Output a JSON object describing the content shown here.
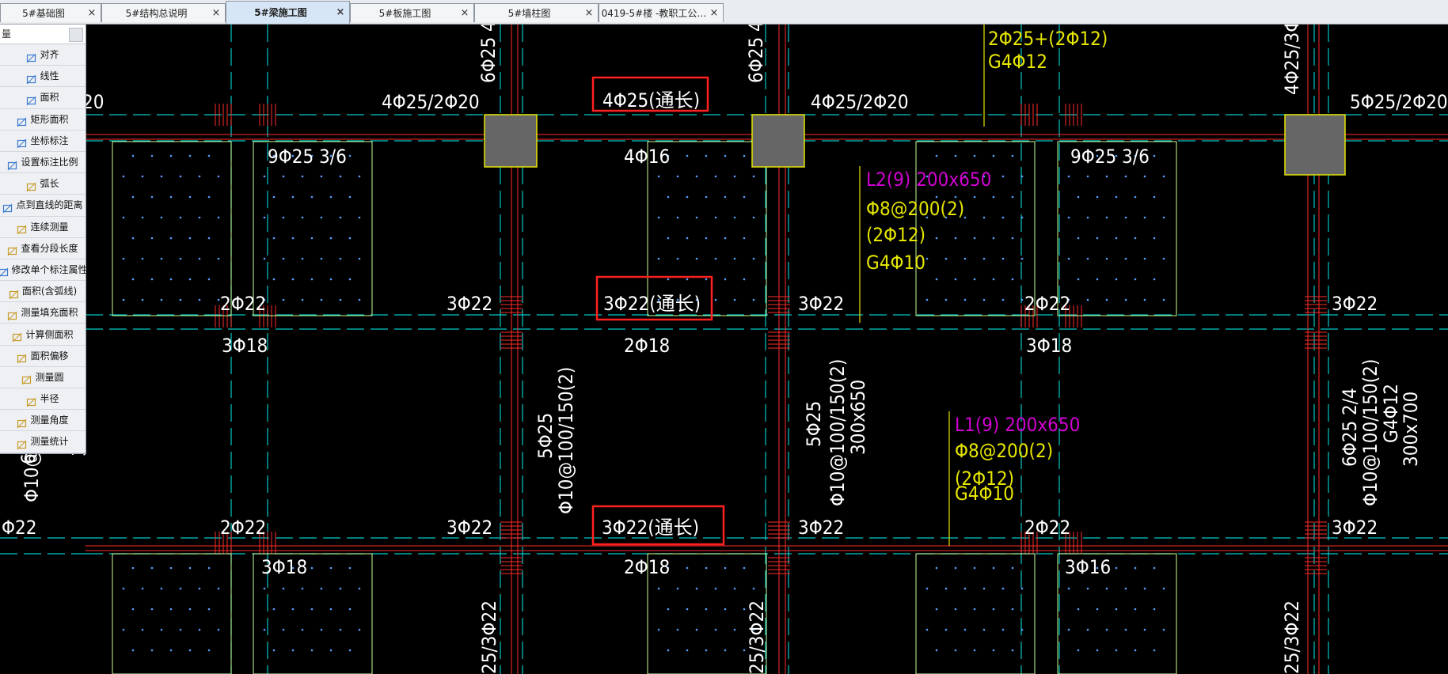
{
  "tabs": [
    {
      "label": "5#基础图",
      "active": false
    },
    {
      "label": "5#结构总说明",
      "active": false
    },
    {
      "label": "5#梁施工图",
      "active": true
    },
    {
      "label": "5#板施工图",
      "active": false
    },
    {
      "label": "5#墙柱图",
      "active": false
    },
    {
      "label": "0419-5#楼 -教职工公…",
      "active": false
    }
  ],
  "close_glyph": "×",
  "tool_panel": {
    "head": "量",
    "tools": [
      {
        "label": "对齐",
        "icon": "align-icon"
      },
      {
        "label": "线性",
        "icon": "linear-icon"
      },
      {
        "label": "面积",
        "icon": "area-icon"
      },
      {
        "label": "矩形面积",
        "icon": "rect-area-icon"
      },
      {
        "label": "坐标标注",
        "icon": "coordinate-icon"
      },
      {
        "label": "设置标注比例",
        "icon": "scale-icon"
      },
      {
        "label": "弧长",
        "icon": "arc-icon"
      },
      {
        "label": "点到直线的距离",
        "icon": "point-line-icon"
      },
      {
        "label": "连续测量",
        "icon": "continuous-icon"
      },
      {
        "label": "查看分段长度",
        "icon": "segment-icon"
      },
      {
        "label": "修改单个标注属性",
        "icon": "edit-dim-icon"
      },
      {
        "label": "面积(含弧线)",
        "icon": "arc-area-icon"
      },
      {
        "label": "测量填充面积",
        "icon": "fill-area-icon"
      },
      {
        "label": "计算侧面积",
        "icon": "side-area-icon"
      },
      {
        "label": "面积偏移",
        "icon": "offset-icon"
      },
      {
        "label": "测量圆",
        "icon": "circle-icon"
      },
      {
        "label": "半径",
        "icon": "radius-icon"
      },
      {
        "label": "测量角度",
        "icon": "angle-icon"
      },
      {
        "label": "测量统计",
        "icon": "stats-icon"
      }
    ]
  },
  "colors": {
    "axis": "#00c8c8",
    "beam": "#ff2a2a",
    "slab": "#c8ff96",
    "text_white": "#ffffff",
    "text_yellow": "#e6e600",
    "text_magenta": "#e000e0",
    "column": "#666666",
    "highlight": "#ff2020"
  },
  "drawing": {
    "labels_white": [
      "4Φ25/2Φ20",
      "4Φ25/2Φ20",
      "5Φ25/2Φ20",
      "20",
      "9Φ25 3/6",
      "9Φ25 3/6",
      "4Φ16",
      "2Φ22",
      "3Φ22",
      "3Φ22",
      "2Φ22",
      "3Φ22",
      "3Φ18",
      "2Φ18",
      "3Φ18",
      "Φ22",
      "2Φ22",
      "3Φ22",
      "3Φ22",
      "2Φ22",
      "3Φ22",
      "3Φ18",
      "2Φ18",
      "3Φ16",
      "6Φ25 4",
      "6Φ25 4/2",
      "4Φ25/3Φ",
      "5Φ25",
      "Φ10@100/150(2)",
      "5Φ25",
      "Φ10@100/150(2)",
      "300x650",
      "6Φ25 2/4",
      "Φ10@100/150(2)",
      "G4Φ12",
      "300x700",
      "6",
      "Φ10@",
      "3",
      "25/3Φ22",
      "25/3Φ22",
      "25/3Φ22"
    ],
    "highlighted_labels": [
      "4Φ25(通长)",
      "3Φ22(通长)",
      "3Φ22(通长)"
    ],
    "l2": [
      "L2(9) 200x650",
      "Φ8@200(2)",
      "(2Φ12)",
      "G4Φ10"
    ],
    "l1": [
      "L1(9) 200x650",
      "Φ8@200(2)",
      "(2Φ12)",
      "G4Φ10"
    ],
    "top_yellow": [
      "2Φ25+(2Φ12)",
      "G4Φ12"
    ]
  }
}
